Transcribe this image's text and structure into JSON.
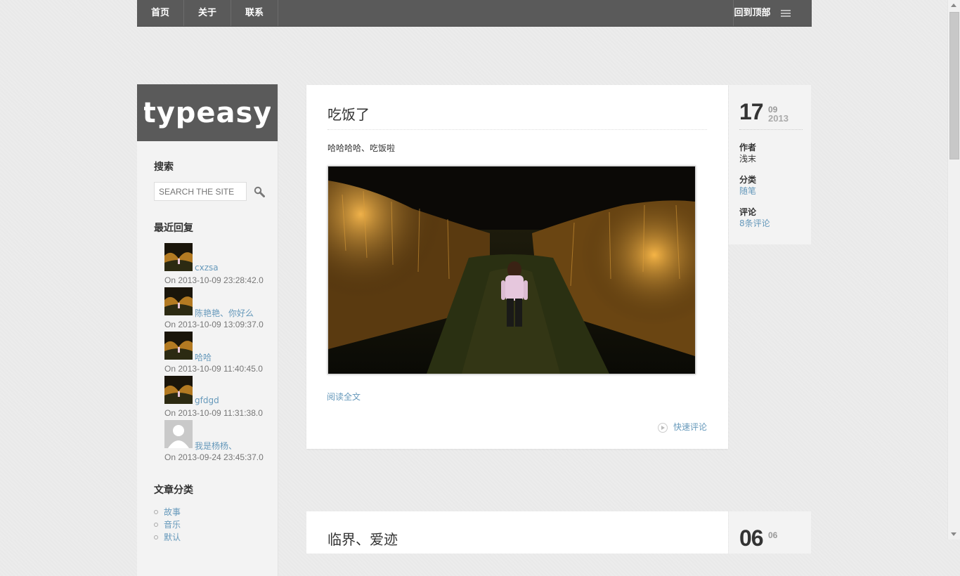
{
  "nav": {
    "items": [
      {
        "label": "首页"
      },
      {
        "label": "关于"
      },
      {
        "label": "联系"
      }
    ],
    "back_to_top": "回到顶部"
  },
  "sidebar": {
    "logo_text": "typeasy",
    "search": {
      "title": "搜索",
      "placeholder": "SEARCH THE SITE"
    },
    "recent_replies": {
      "title": "最近回复",
      "items": [
        {
          "name": "cxzsa",
          "date": "On 2013-10-09 23:28:42.0",
          "avatar": "field-thumbnail"
        },
        {
          "name": "陈艳艳、你好么",
          "date": "On 2013-10-09 13:09:37.0",
          "avatar": "field-thumbnail"
        },
        {
          "name": "哈哈",
          "date": "On 2013-10-09 11:40:45.0",
          "avatar": "field-thumbnail"
        },
        {
          "name": "gfdgd",
          "date": "On 2013-10-09 11:31:38.0",
          "avatar": "field-thumbnail"
        },
        {
          "name": "我是杨杨、",
          "date": "On 2013-09-24 23:45:37.0",
          "avatar": "default-user-avatar"
        }
      ]
    },
    "categories": {
      "title": "文章分类",
      "items": [
        "故事",
        "音乐",
        "默认"
      ]
    }
  },
  "post": {
    "title": "吃饭了",
    "excerpt": "哈哈哈哈、吃饭啦",
    "read_more": "阅读全文",
    "quick_comment": "快速评论",
    "meta": {
      "day": "17",
      "month": "09",
      "year": "2013",
      "author_label": "作者",
      "author": "浅末",
      "category_label": "分类",
      "category": "随笔",
      "comments_label": "评论",
      "comments": "8条评论"
    }
  },
  "post2": {
    "title": "临界、爱迹",
    "day": "06",
    "month": "06"
  },
  "colors": {
    "topbar": "#5a5a5a",
    "link": "#6699bb",
    "background": "#ececec"
  }
}
